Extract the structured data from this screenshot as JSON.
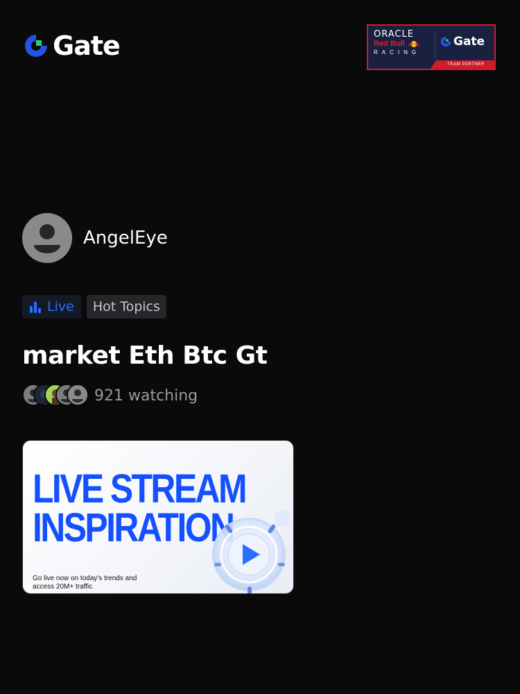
{
  "brand": {
    "name": "Gate",
    "accent": "#2354e6",
    "accent_green": "#2ad07a"
  },
  "partner_badge": {
    "oracle": "ORACLE",
    "red_bull": "Red Bull",
    "racing": "RACING",
    "partner_brand": "Gate",
    "strip": "TEAM PARTNER"
  },
  "host": {
    "name": "AngelEye",
    "avatar_icon": "person-icon"
  },
  "tags": {
    "live": "Live",
    "topic": "Hot Topics"
  },
  "stream": {
    "title": "market Eth Btc Gt",
    "watching": "921 watching"
  },
  "banner": {
    "headline_line1": "LIVE STREAM",
    "headline_line2": "INSPIRATION",
    "subtext_line1": "Go live now on today's trends and",
    "subtext_line2": "access 20M+ traffic",
    "art_icon": "play-icon"
  },
  "colors": {
    "background": "#0a0a0a",
    "live_blue": "#2b6fff",
    "muted_text": "#9a9aa0"
  }
}
